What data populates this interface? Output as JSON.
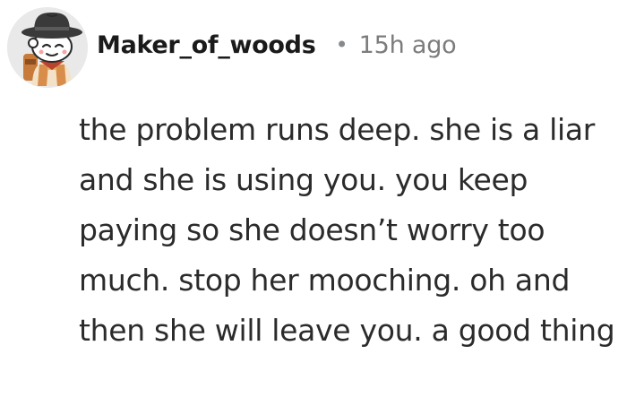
{
  "comment": {
    "avatar_icon": "cowboy-snoo-avatar-icon",
    "author": "Maker_of_woods",
    "separator": "•",
    "timestamp": "15h ago",
    "body": "the problem runs deep. she is a liar and she is using you. you keep paying so she doesn’t worry too much. stop her mooching. oh and then she will leave you. a good thing"
  }
}
